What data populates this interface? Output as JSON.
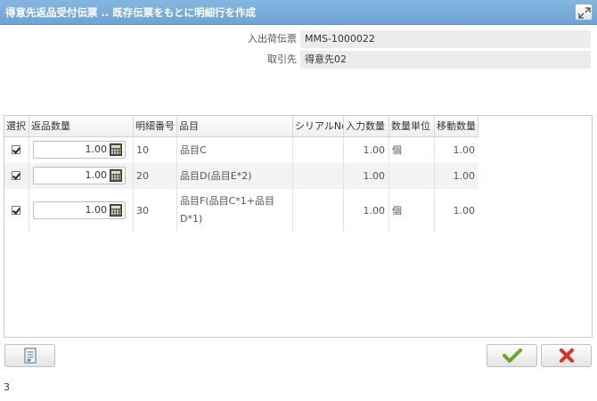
{
  "window": {
    "title": "得意先返品受付伝票 .. 既存伝票をもとに明細行を作成",
    "maximize_icon": "expand-icon"
  },
  "form": {
    "voucher_label": "入出荷伝票",
    "voucher_value": "MMS-1000022",
    "partner_label": "取引先",
    "partner_value": "得意先02"
  },
  "grid": {
    "columns": [
      "選択",
      "返品数量",
      "明細番号",
      "品目",
      "シリアルNo",
      "入力数量",
      "数量単位",
      "移動数量"
    ],
    "rows": [
      {
        "selected": true,
        "return_qty": "1.00",
        "line_no": "10",
        "item_line1": "品目C",
        "item_line2": "",
        "serial": "",
        "input_qty": "1.00",
        "unit": "個",
        "move_qty": "1.00"
      },
      {
        "selected": true,
        "return_qty": "1.00",
        "line_no": "20",
        "item_line1": "品目D(品目E*2)",
        "item_line2": "",
        "serial": "",
        "input_qty": "1.00",
        "unit": "",
        "move_qty": "1.00"
      },
      {
        "selected": true,
        "return_qty": "1.00",
        "line_no": "30",
        "item_line1": "品目F(品目C*1+品目",
        "item_line2": "D*1)",
        "serial": "",
        "input_qty": "1.00",
        "unit": "個",
        "move_qty": "1.00"
      }
    ]
  },
  "toolbar": {
    "export_icon": "document-icon",
    "confirm_icon": "checkmark-icon",
    "cancel_icon": "close-icon",
    "confirm_color": "#6aa82a",
    "cancel_color": "#d9312b"
  },
  "status": {
    "count": "3"
  }
}
